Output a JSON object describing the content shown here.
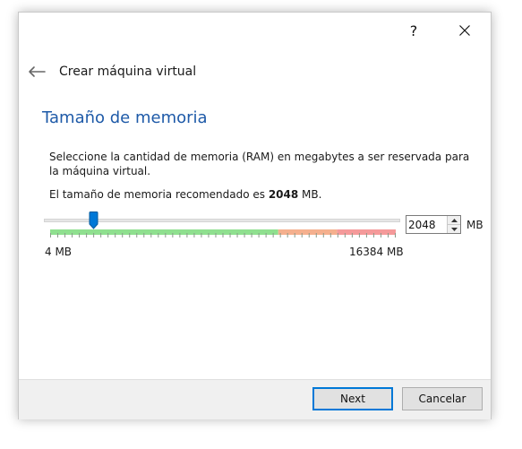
{
  "titlebar": {
    "help_label": "?",
    "close_icon": "close-icon"
  },
  "header": {
    "back_icon": "arrow-left-icon",
    "wizard_title": "Crear máquina virtual"
  },
  "page": {
    "title": "Tamaño de memoria",
    "description": "Seleccione la cantidad de memoria (RAM) en megabytes a ser reservada para la máquina virtual.",
    "recommended_prefix": "El tamaño de memoria recomendado es ",
    "recommended_value": "2048",
    "recommended_suffix": " MB."
  },
  "memory": {
    "value": "2048",
    "unit": "MB",
    "min_value": 4,
    "max_value": 16384,
    "current_value": 2048,
    "min_label": "4 MB",
    "max_label": "16384 MB",
    "zones": [
      {
        "color": "#8fe08f",
        "end_fraction": 0.66
      },
      {
        "color": "#f5b08e",
        "end_fraction": 0.83
      },
      {
        "color": "#f59a9a",
        "end_fraction": 1.0
      }
    ],
    "accent_color": "#0078d7"
  },
  "footer": {
    "next_label": "Next",
    "cancel_label": "Cancelar"
  }
}
